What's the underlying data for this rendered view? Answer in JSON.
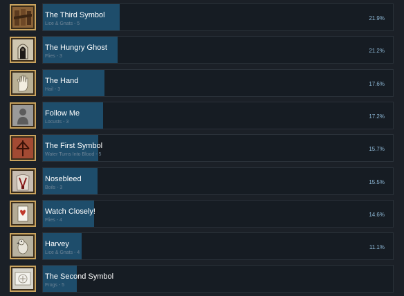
{
  "achievements": [
    {
      "title": "The Third Symbol",
      "detail": "Lice & Gnats - 5",
      "percent_label": "21.9%",
      "percent": 21.9,
      "icon": "wooden-planks-icon"
    },
    {
      "title": "The Hungry Ghost",
      "detail": "Flies - 3",
      "percent_label": "21.2%",
      "percent": 21.2,
      "icon": "hooded-figure-icon"
    },
    {
      "title": "The Hand",
      "detail": "Hail - 3",
      "percent_label": "17.6%",
      "percent": 17.6,
      "icon": "hand-icon"
    },
    {
      "title": "Follow Me",
      "detail": "Locusts - 3",
      "percent_label": "17.2%",
      "percent": 17.2,
      "icon": "silhouette-icon"
    },
    {
      "title": "The First Symbol",
      "detail": "Water Turns Into Blood - 5",
      "percent_label": "15.7%",
      "percent": 15.7,
      "icon": "red-rune-icon"
    },
    {
      "title": "Nosebleed",
      "detail": "Boils - 3",
      "percent_label": "15.5%",
      "percent": 15.5,
      "icon": "torso-icon"
    },
    {
      "title": "Watch Closely!",
      "detail": "Flies - 4",
      "percent_label": "14.6%",
      "percent": 14.6,
      "icon": "playing-card-icon"
    },
    {
      "title": "Harvey",
      "detail": "Lice & Gnats - 4",
      "percent_label": "11.1%",
      "percent": 11.1,
      "icon": "parrot-icon"
    },
    {
      "title": "The Second Symbol",
      "detail": "Frogs - 5",
      "percent_label": "",
      "percent": 9.7,
      "icon": "white-sigil-icon"
    }
  ],
  "colors": {
    "bar_fill": "#1e4d6b",
    "panel_bg": "#161c23",
    "frame": "#c9a35e"
  }
}
